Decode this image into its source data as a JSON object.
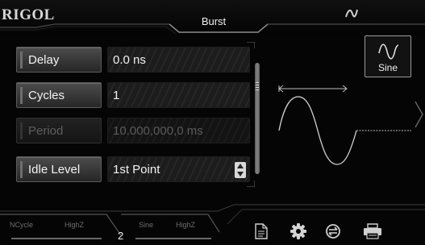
{
  "header": {
    "logo": "RIGOL",
    "title": "Burst",
    "status_icon": "waveform-status-icon"
  },
  "params": [
    {
      "label": "Delay",
      "value": "0.0 ns",
      "enabled": true,
      "selectable": false
    },
    {
      "label": "Cycles",
      "value": "1",
      "enabled": true,
      "selectable": false
    },
    {
      "label": "Period",
      "value": "10.000,000,0 ms",
      "enabled": false,
      "selectable": false
    },
    {
      "label": "Idle Level",
      "value": "1st Point",
      "enabled": true,
      "selectable": true
    }
  ],
  "waveform_button": {
    "label": "Sine",
    "icon": "sine-wave-icon"
  },
  "channels": [
    {
      "number": "",
      "mode": "NCycle",
      "impedance": "HighZ"
    },
    {
      "number": "2",
      "mode": "Sine",
      "impedance": "HighZ"
    }
  ],
  "toolbar": {
    "icons": [
      "document-icon",
      "gear-icon",
      "sync-icon",
      "printer-icon"
    ]
  },
  "colors": {
    "background": "#050505",
    "text": "#f2f2f2",
    "dim_text": "#5a5a5a"
  }
}
